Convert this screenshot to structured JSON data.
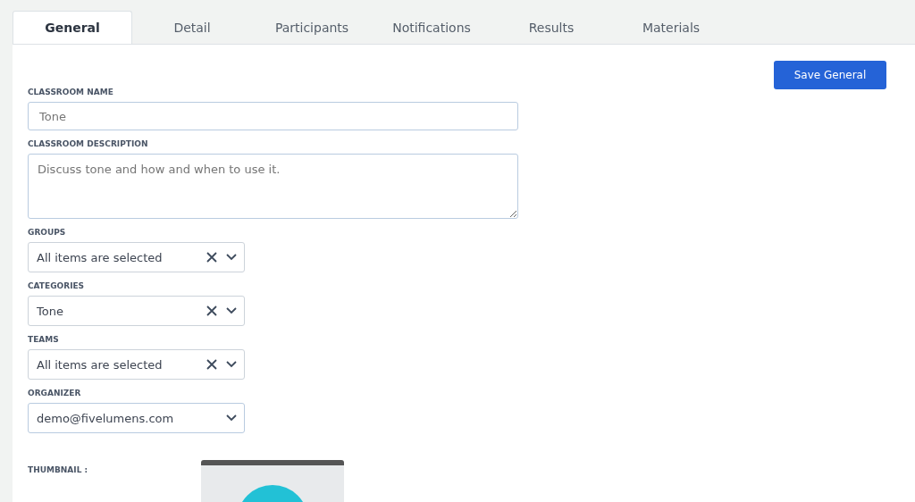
{
  "tabs": [
    {
      "label": "General",
      "selected": true
    },
    {
      "label": "Detail",
      "selected": false
    },
    {
      "label": "Participants",
      "selected": false
    },
    {
      "label": "Notifications",
      "selected": false
    },
    {
      "label": "Results",
      "selected": false
    },
    {
      "label": "Materials",
      "selected": false
    }
  ],
  "save_button": "Save General",
  "fields": [
    {
      "kind": "text",
      "label": "CLASSROOM NAME",
      "placeholder": "Tone"
    },
    {
      "kind": "textarea",
      "label": "CLASSROOM DESCRIPTION",
      "placeholder": "Discuss tone and how and when to use it."
    },
    {
      "kind": "multiselect",
      "label": "GROUPS",
      "value": "All items are selected"
    },
    {
      "kind": "multiselect",
      "label": "CATEGORIES",
      "value": "Tone"
    },
    {
      "kind": "multiselect",
      "label": "TEAMS",
      "value": "All items are selected"
    },
    {
      "kind": "select",
      "label": "ORGANIZER",
      "value": "demo@fivelumens.com"
    }
  ],
  "thumbnail": {
    "label": "THUMBNAIL :"
  }
}
